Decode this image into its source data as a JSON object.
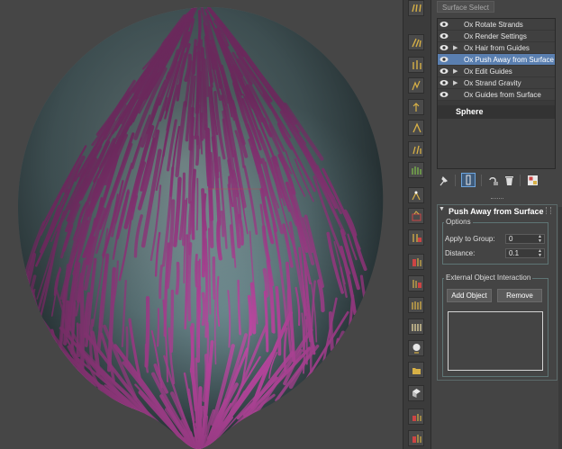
{
  "surface_select_label": "Surface Select",
  "modifier_stack": {
    "items": [
      {
        "label": "Ox Rotate Strands",
        "expandable": false,
        "selected": false
      },
      {
        "label": "Ox Render Settings",
        "expandable": false,
        "selected": false
      },
      {
        "label": "Ox Hair from Guides",
        "expandable": true,
        "selected": false
      },
      {
        "label": "Ox Push Away from Surface",
        "expandable": false,
        "selected": true
      },
      {
        "label": "Ox Edit Guides",
        "expandable": true,
        "selected": false
      },
      {
        "label": "Ox Strand Gravity",
        "expandable": true,
        "selected": false
      },
      {
        "label": "Ox Guides from Surface",
        "expandable": false,
        "selected": false
      }
    ],
    "base_object": "Sphere"
  },
  "stack_toolbar": {
    "icons": [
      "pin-stack-icon",
      "show-end-result-icon",
      "make-unique-icon",
      "remove-modifier-icon",
      "configure-sets-icon"
    ]
  },
  "rollout": {
    "title": "Push Away from Surface",
    "options_group": {
      "label": "Options",
      "apply_to_group_label": "Apply to Group:",
      "apply_to_group_value": "0",
      "distance_label": "Distance:",
      "distance_value": "0.1"
    },
    "external_group": {
      "label": "External Object Interaction",
      "add_button": "Add Object",
      "remove_button": "Remove"
    }
  },
  "colors": {
    "hair": "#c04aa6",
    "sphere": "#7fa3a8",
    "viewport_bg": "#464646",
    "selection": "#5a7fb0"
  }
}
